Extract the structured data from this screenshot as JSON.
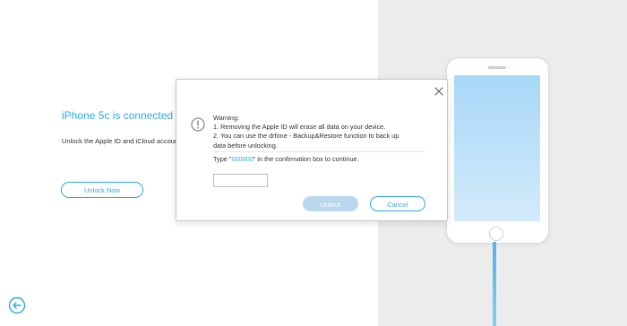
{
  "device": {
    "title": "iPhone 5c is connected",
    "description": "Unlock the Apple ID and iCloud account",
    "unlock_now_label": "Unlock Now"
  },
  "dialog": {
    "warning_title": "Warning:",
    "warning_line1": "1. Removing the Apple ID will erase all data on your device.",
    "warning_line2": "2. You can use the drfone - Backup&Restore function to back up",
    "warning_line3": "data before unlocking.",
    "confirm_prefix": "Type \"",
    "confirm_code": "000000",
    "confirm_suffix": "\" in the confirmation box to continue.",
    "confirm_input_value": "",
    "unlock_label": "Unlock",
    "cancel_label": "Cancel"
  },
  "icons": {
    "back": "back-arrow-icon",
    "close": "close-icon",
    "warning": "warning-icon"
  },
  "colors": {
    "accent": "#2fa9e0",
    "disabled_button": "#b9d8ee",
    "right_panel_bg": "#ececec"
  }
}
